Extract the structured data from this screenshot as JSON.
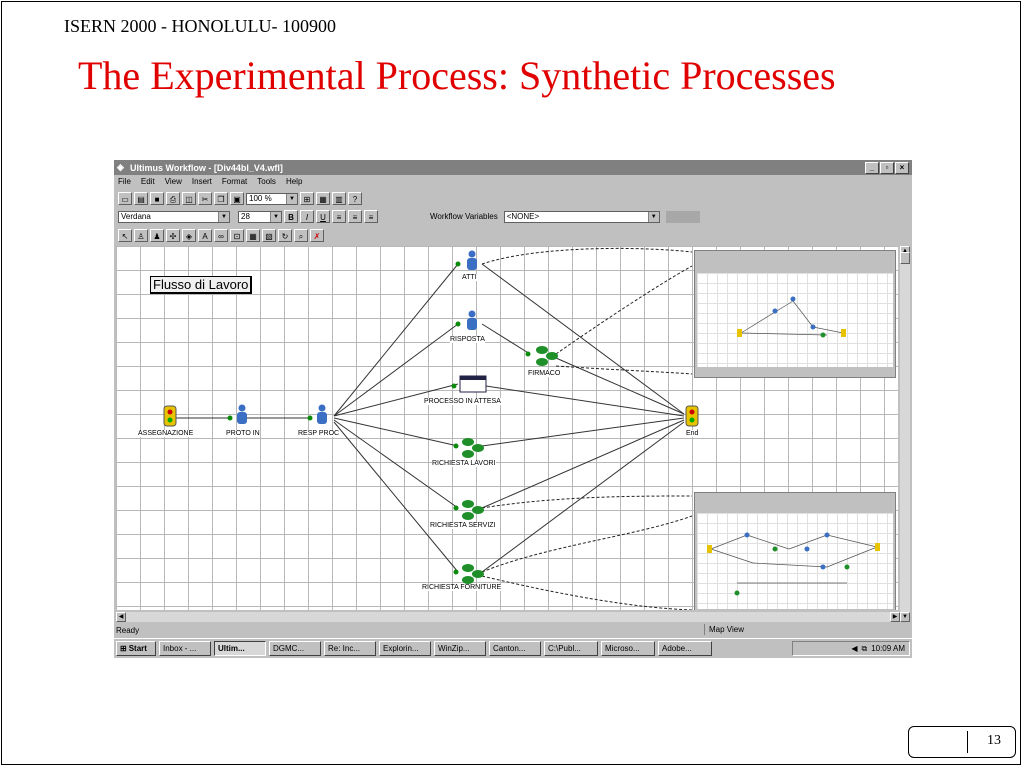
{
  "slide": {
    "header": "ISERN 2000  - HONOLULU- 100900",
    "title": "The Experimental Process: Synthetic Processes",
    "page_number": "13"
  },
  "window": {
    "title": "Ultimus Workflow - [Div44bl_V4.wfl]",
    "menu": [
      "File",
      "Edit",
      "View",
      "Insert",
      "Format",
      "Tools",
      "Help"
    ],
    "zoom": "100 %",
    "font_name": "Verdana",
    "font_size": "28",
    "workflow_variables_label": "Workflow Variables",
    "workflow_variables_value": "<NONE>"
  },
  "diagram": {
    "banner": "Flusso di Lavoro",
    "nodes": {
      "assegnazione": "ASSEGNAZIONE",
      "proto_in": "PROTO IN",
      "resp_proc": "RESP PROC",
      "atti": "ATTI",
      "risposta": "RISPOSTA",
      "firmaco": "FIRMACO",
      "processo_in_attesa": "PROCESSO IN ATTESA",
      "richiesta_lavori": "RICHIESTA LAVORI",
      "richiesta_servizi": "RICHIESTA SERVIZI",
      "richiesta_forniture": "RICHIESTA FORNITURE",
      "end": "End"
    }
  },
  "status": {
    "ready": "Ready",
    "map_view": "Map View"
  },
  "taskbar": {
    "start": "Start",
    "tasks": [
      "Inbox - ...",
      "Ultim...",
      "DGMC...",
      "Re: Inc...",
      "Explorin...",
      "WinZip...",
      "Canton...",
      "C:\\Publ...",
      "Microso...",
      "Adobe..."
    ],
    "clock": "10:09 AM"
  },
  "colors": {
    "title_red": "#e00000",
    "node_green": "#1f8f2a",
    "node_blue": "#3a6fc4"
  }
}
